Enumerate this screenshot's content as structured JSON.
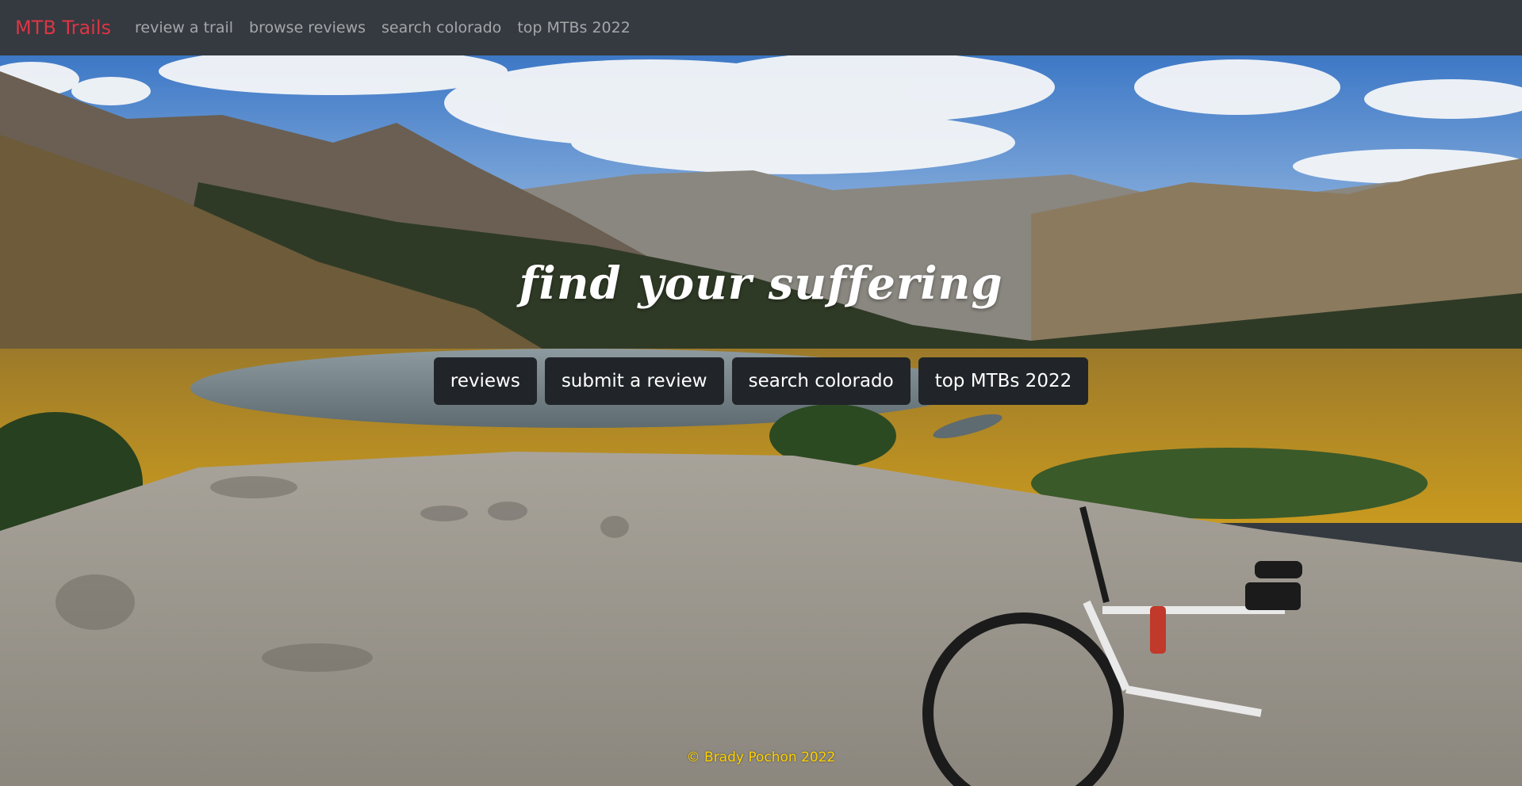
{
  "navbar": {
    "brand": "MTB Trails",
    "links": [
      {
        "label": "review a trail"
      },
      {
        "label": "browse reviews"
      },
      {
        "label": "search colorado"
      },
      {
        "label": "top MTBs 2022"
      }
    ]
  },
  "hero": {
    "tagline": "find your suffering",
    "buttons": [
      {
        "label": "reviews"
      },
      {
        "label": "submit a review"
      },
      {
        "label": "search colorado"
      },
      {
        "label": "top MTBs 2022"
      }
    ]
  },
  "footer": {
    "copyright": "© Brady Pochon 2022"
  },
  "colors": {
    "navbar_bg": "#343a40",
    "brand": "#dc3545",
    "button_bg": "#212529",
    "footer_text": "#ffd200"
  }
}
